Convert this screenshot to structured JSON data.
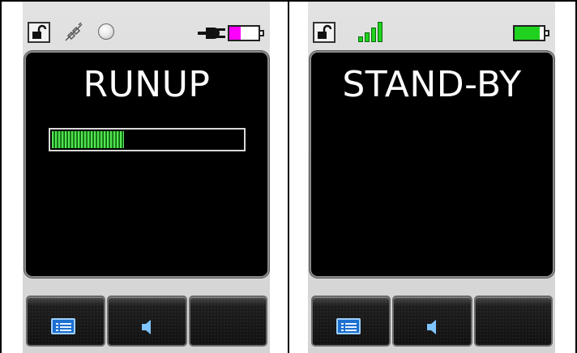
{
  "panels": {
    "left": {
      "state_title": "RUNUP",
      "status_icons": [
        "lock-open-icon",
        "plug-slash-icon",
        "circle-icon",
        "power-plug-icon",
        "battery-icon"
      ],
      "battery_level": 0.4,
      "battery_color": "#ff00ff",
      "progress": 0.38,
      "progress_color": "#2ed22e",
      "buttons": [
        {
          "icon": "menu-icon"
        },
        {
          "icon": "speaker-icon"
        },
        {
          "icon": ""
        }
      ]
    },
    "right": {
      "state_title": "STAND-BY",
      "status_icons": [
        "lock-open-icon",
        "signal-icon",
        "battery-icon"
      ],
      "signal_bars": 4,
      "battery_level": 0.85,
      "battery_color": "#1fd21f",
      "buttons": [
        {
          "icon": "menu-icon"
        },
        {
          "icon": "speaker-icon"
        },
        {
          "icon": ""
        }
      ]
    }
  },
  "colors": {
    "screen_bg": "#000000",
    "panel_bg": "#d9d9d9",
    "title_text": "#ffffff",
    "menu_icon_blue": "#1d6fd0",
    "speaker_blue": "#7ec4ff"
  }
}
